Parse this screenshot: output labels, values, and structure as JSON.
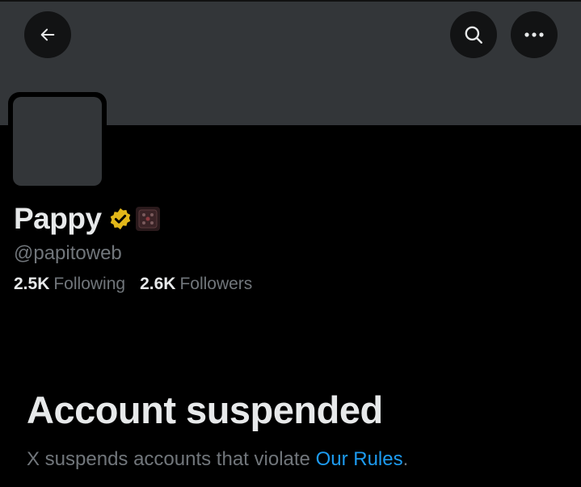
{
  "colors": {
    "background": "#000000",
    "banner": "#333639",
    "text_primary": "#e7e9ea",
    "text_secondary": "#71767b",
    "link": "#1d9bf0",
    "verified_badge": "#e2b719"
  },
  "header": {
    "back_icon": "arrow-left-icon",
    "search_icon": "search-icon",
    "more_icon": "more-horizontal-icon"
  },
  "profile": {
    "name": "Pappy",
    "handle": "@papitoweb",
    "verified_icon": "gold-verified-badge-icon",
    "affiliate_icon": "affiliate-badge-icon",
    "following_count": "2.5K",
    "following_label": "Following",
    "followers_count": "2.6K",
    "followers_label": "Followers"
  },
  "suspension": {
    "title": "Account suspended",
    "message_prefix": "X suspends accounts that violate ",
    "rules_link": "Our Rules",
    "message_suffix": "."
  }
}
